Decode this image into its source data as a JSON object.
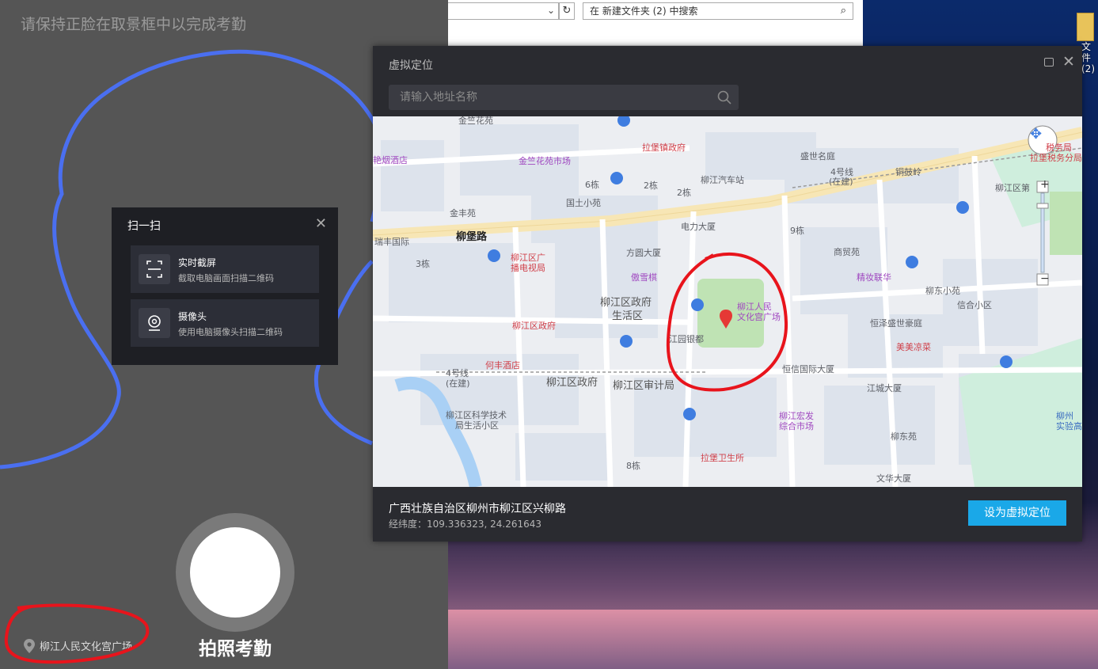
{
  "explorer": {
    "search_placeholder": "在 新建文件夹 (2) 中搜索"
  },
  "desktop": {
    "icon_label_line1": "文件",
    "icon_label_line2": "(2)"
  },
  "attendance": {
    "tip": "请保持正脸在取景框中以完成考勤",
    "shutter_label": "拍照考勤",
    "location_label": "柳江人民文化宫广场",
    "outline_color": "#4a6ff0",
    "annotation_color": "#e8141c"
  },
  "scan_popup": {
    "title": "扫一扫",
    "options": [
      {
        "title": "实时截屏",
        "subtitle": "截取电脑画面扫描二维码",
        "icon": "screen-capture-icon"
      },
      {
        "title": "摄像头",
        "subtitle": "使用电脑摄像头扫描二维码",
        "icon": "webcam-icon"
      }
    ]
  },
  "virtual_location": {
    "title": "虚拟定位",
    "search_placeholder": "请输入地址名称",
    "address": "广西壮族自治区柳州市柳江区兴柳路",
    "coords_label": "经纬度：109.336323, 24.261643",
    "set_button": "设为虚拟定位",
    "accent": "#1aa8e8"
  },
  "map": {
    "labels": {
      "jinzhu_huayuan": "金竺花苑",
      "lapu_zhen_zhengfu": "拉堡镇政府",
      "shengshi_mingting": "盛世名庭",
      "shuiwu_1": "税务局",
      "shuiwu_2": "拉堡税务分局",
      "yanyan_jiudian": "艳烟酒店",
      "jinzhu_huayuan_shichang": "金竺花苑市场",
      "liujiang_qiche_zhan": "柳江汽车站",
      "hao4_line": "4号线",
      "zaijian": "(在建)",
      "tonggu_ling": "铜鼓岭",
      "liujiang_qu_di": "柳江区第",
      "qi_6dong": "6栋",
      "qi_2dong_a": "2栋",
      "qi_2dong_b": "2栋",
      "guotu_xiaoyuan": "国土小苑",
      "jinfeng_yuan": "金丰苑",
      "liupu_lu": "柳堡路",
      "dianli_dasha": "电力大厦",
      "ruifeng_guoji": "瑞丰国际",
      "qi_3dong": "3栋",
      "liujiang_qu_guangbo": "柳江区广",
      "bo_dianshiju": "播电视局",
      "fangyuan_dasha": "方圆大厦",
      "qi_9dong": "9栋",
      "shangmao_yuan": "商贸苑",
      "aoxue_qi": "傲雪棋",
      "jingzhuang_hua": "精妆联华",
      "liudong_xiaoyuan": "柳东小苑",
      "xinhe_xiaoqu": "信合小区",
      "zhengfu_shenghuo": "柳江区政府",
      "shenghuo_qu": "生活区",
      "renmin_wenhua_1": "柳江人民",
      "renmin_wenhua_2": "文化宫广场",
      "hengze_shengshi": "恒泽盛世豪庭",
      "liujiang_zhengfu": "柳江区政府",
      "yinyuan_yindu": "江园银都",
      "meimei_liangcai": "美美凉菜",
      "hefeng_jiudian": "何丰酒店",
      "hengxin_guoji": "恒信国际大厦",
      "hao4_line_b": "4号线",
      "zaijian_b": "(在建)",
      "liujiang_zhengfu_b": "柳江区政府",
      "liujiang_shenji": "柳江区审计局",
      "jiangcheng_dasha": "江城大厦",
      "keji_1": "柳江区科学技术",
      "keji_2": "局生活小区",
      "hongfa_1": "柳江宏发",
      "hongfa_2": "综合市场",
      "liudong_yuan": "柳东苑",
      "liuzhou_shiyan_1": "柳州",
      "liuzhou_shiyan_2": "实验高",
      "lapu_weisheng": "拉堡卫生所",
      "qi_8dong": "8栋",
      "wenhua_dasha": "文华大厦",
      "jinzhu_huayuan_top": "金竺花苑"
    }
  }
}
